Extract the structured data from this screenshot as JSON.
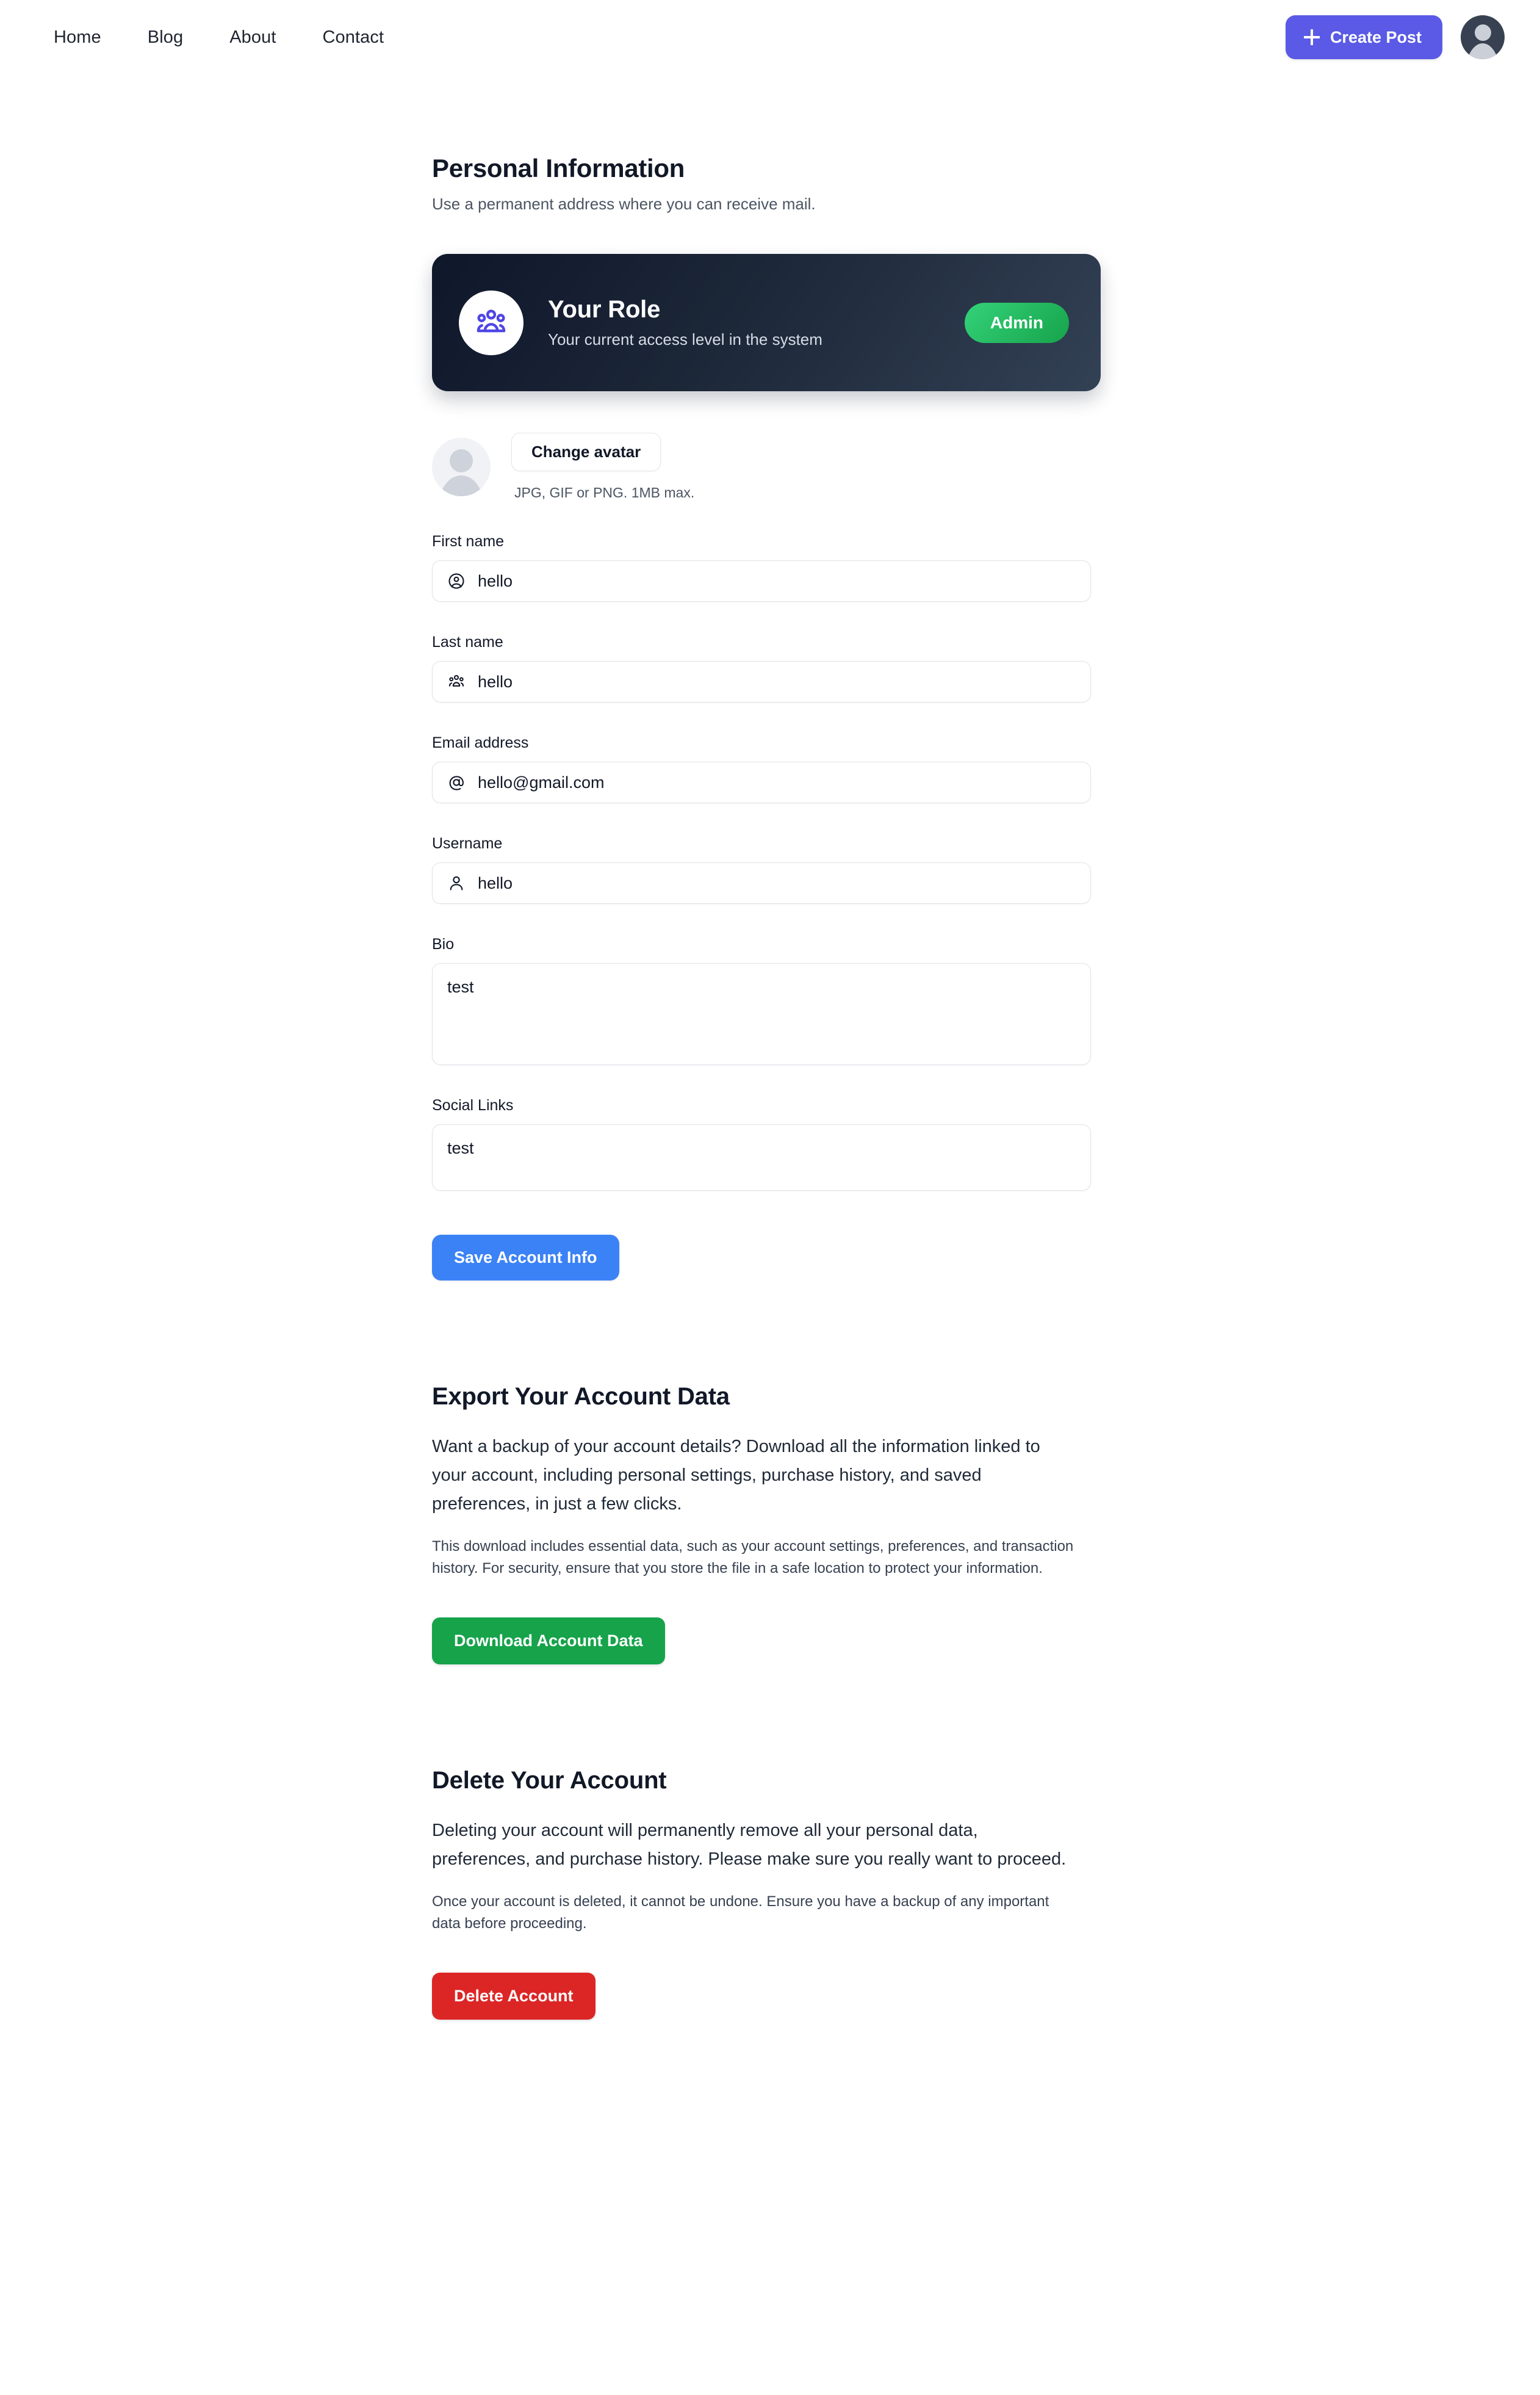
{
  "navbar": {
    "links": [
      {
        "label": "Home"
      },
      {
        "label": "Blog"
      },
      {
        "label": "About"
      },
      {
        "label": "Contact"
      }
    ],
    "create_post_label": "Create Post",
    "plus_icon": "plus-icon",
    "avatar_icon": "user-avatar-icon"
  },
  "header": {
    "title": "Personal Information",
    "subtitle": "Use a permanent address where you can receive mail."
  },
  "role_card": {
    "icon": "users-group-icon",
    "title": "Your Role",
    "subtitle": "Your current access level in the system",
    "badge": "Admin",
    "badge_color": "#22c55e",
    "background_color": "#1c2738"
  },
  "avatar_section": {
    "avatar_icon": "user-placeholder-icon",
    "change_label": "Change avatar",
    "hint": "JPG, GIF or PNG. 1MB max."
  },
  "form": {
    "fields": [
      {
        "label": "First name",
        "value": "hello",
        "placeholder": "First name",
        "icon": "user-circle-icon",
        "type": "input"
      },
      {
        "label": "Last name",
        "value": "hello",
        "placeholder": "Last name",
        "icon": "users-group-icon",
        "type": "input"
      },
      {
        "label": "Email address",
        "value": "hello@gmail.com",
        "placeholder": "Email address",
        "icon": "at-sign-icon",
        "type": "input"
      },
      {
        "label": "Username",
        "value": "hello",
        "placeholder": "Username",
        "icon": "user-icon",
        "type": "input"
      },
      {
        "label": "Bio",
        "value": "test",
        "placeholder": "Bio",
        "type": "textarea"
      },
      {
        "label": "Social Links",
        "value": "test",
        "placeholder": "Social Links",
        "type": "textarea"
      }
    ],
    "save_label": "Save Account Info",
    "save_color": "#3b82f6"
  },
  "export_section": {
    "title": "Export Your Account Data",
    "lead": "Want a backup of your account details? Download all the information linked to your account, including personal settings, purchase history, and saved preferences, in just a few clicks.",
    "note": "This download includes essential data, such as your account settings, preferences, and transaction history. For security, ensure that you store the file in a safe location to protect your information.",
    "button_label": "Download Account Data",
    "button_color": "#16a34a"
  },
  "delete_section": {
    "title": "Delete Your Account",
    "lead": "Deleting your account will permanently remove all your personal data, preferences, and purchase history. Please make sure you really want to proceed.",
    "note": "Once your account is deleted, it cannot be undone. Ensure you have a backup of any important data before proceeding.",
    "button_label": "Delete Account",
    "button_color": "#dc2626"
  }
}
